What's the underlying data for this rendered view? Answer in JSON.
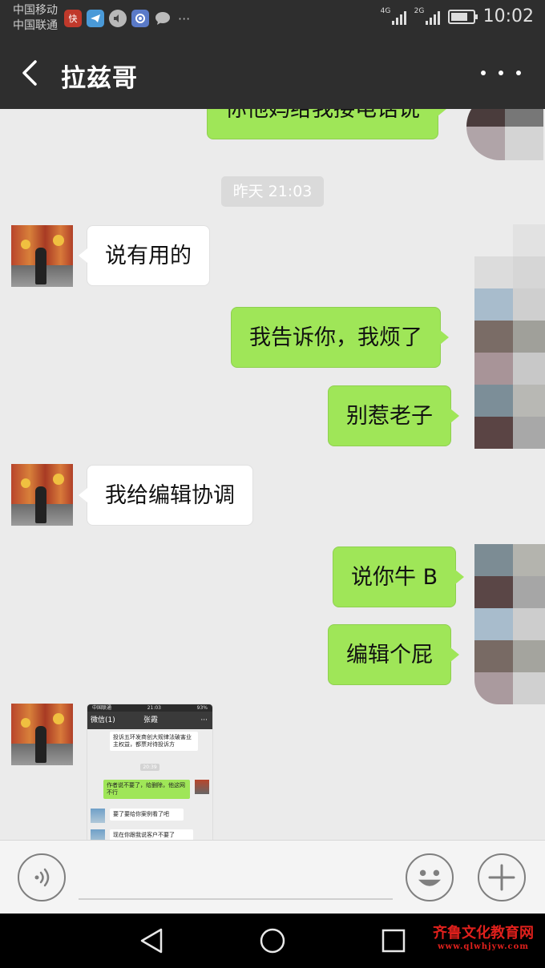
{
  "status_bar": {
    "carrier_1": "中国移动",
    "carrier_2": "中国联通",
    "network_1": "4G",
    "network_2": "2G",
    "time": "10:02",
    "app_icons": [
      "news-app-icon",
      "telegram-icon",
      "volume-icon",
      "settings-app-icon",
      "chat-icon"
    ],
    "more_dots": "···"
  },
  "header": {
    "title": "拉兹哥"
  },
  "messages": [
    {
      "side": "out",
      "text": "你他妈给我接电话说"
    },
    {
      "side": "out",
      "text": "我告诉你，我烦了"
    },
    {
      "side": "out",
      "text": "别惹老子"
    },
    {
      "side": "out",
      "text": "说你牛 B"
    },
    {
      "side": "out",
      "text": "编辑个屁"
    }
  ],
  "incoming": [
    {
      "side": "in",
      "text": "说有用的"
    },
    {
      "side": "in",
      "text": "我给编辑协调"
    }
  ],
  "timestamp": "昨天 21:03",
  "screenshot_thumb": {
    "status_left": "中国联通",
    "status_time": "21:03",
    "status_right": "93%",
    "back_label": "微信(1)",
    "title": "张霞",
    "more": "···",
    "text_1": "投诉五环发商创大规律法破害业主权益，都票对待投诉方",
    "time": "20:39",
    "text_2": "作者说不要了，给删除，他这网不行",
    "text_3": "要了要给你案例看了吧",
    "text_4": "现在你跟我说客户不要了"
  },
  "watermark": {
    "line_1": "齐鲁文化教育网",
    "line_2": "www.qlwhjyw.com"
  },
  "colors": {
    "bar_bg": "#2e2e2e",
    "chat_bg": "#ebebeb",
    "bubble_out": "#9fe658",
    "bubble_in": "#ffffff"
  }
}
